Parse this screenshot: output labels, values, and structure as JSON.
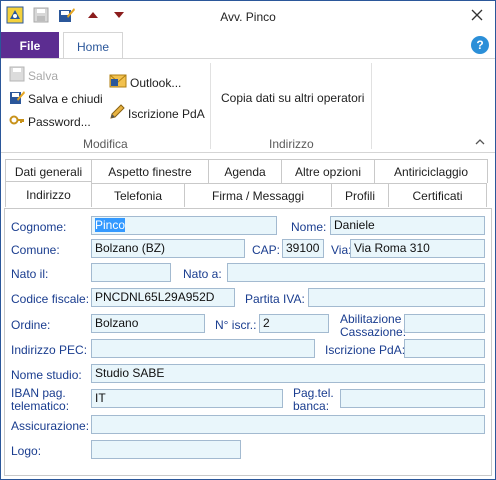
{
  "window": {
    "title": "Avv. Pinco"
  },
  "ribbon": {
    "tab_file": "File",
    "tab_home": "Home",
    "modifica": {
      "label": "Modifica",
      "salva": "Salva",
      "salva_chiudi": "Salva e chiudi",
      "password": "Password...",
      "outlook": "Outlook...",
      "iscrizione": "Iscrizione PdA"
    },
    "indirizzo": {
      "label": "Indirizzo",
      "copia": "Copia dati su altri operatori"
    }
  },
  "tabs": {
    "row1": [
      "Dati generali",
      "Aspetto finestre",
      "Agenda",
      "Altre opzioni",
      "Antiriciclaggio"
    ],
    "row2": [
      "Indirizzo",
      "Telefonia",
      "Firma / Messaggi",
      "Profili",
      "Certificati"
    ],
    "active": "Indirizzo"
  },
  "form": {
    "cognome": {
      "label": "Cognome:",
      "value": "Pinco"
    },
    "nome": {
      "label": "Nome:",
      "value": "Daniele"
    },
    "comune": {
      "label": "Comune:",
      "value": "Bolzano (BZ)"
    },
    "cap": {
      "label": "CAP:",
      "value": "39100"
    },
    "via": {
      "label": "Via:",
      "value": "Via Roma 310"
    },
    "nato_il": {
      "label": "Nato il:",
      "value": ""
    },
    "nato_a": {
      "label": "Nato a:",
      "value": ""
    },
    "codice_fiscale": {
      "label": "Codice fiscale:",
      "value": "PNCDNL65L29A952D"
    },
    "partita_iva": {
      "label": "Partita IVA:",
      "value": ""
    },
    "ordine": {
      "label": "Ordine:",
      "value": "Bolzano"
    },
    "n_iscr": {
      "label": "N° iscr.:",
      "value": "2"
    },
    "abilitazione": {
      "label1": "Abilitazione",
      "label2": "Cassazione:",
      "value": ""
    },
    "pec": {
      "label": "Indirizzo PEC:",
      "value": ""
    },
    "iscrizione_pda": {
      "label": "Iscrizione PdA:",
      "value": ""
    },
    "nome_studio": {
      "label": "Nome studio:",
      "value": "Studio SABE"
    },
    "iban": {
      "label1": "IBAN pag.",
      "label2": "telematico:",
      "value": "IT"
    },
    "pag_tel": {
      "label1": "Pag.tel.",
      "label2": "banca:",
      "value": ""
    },
    "assicurazione": {
      "label": "Assicurazione:",
      "value": ""
    },
    "logo": {
      "label": "Logo:",
      "value": ""
    }
  }
}
